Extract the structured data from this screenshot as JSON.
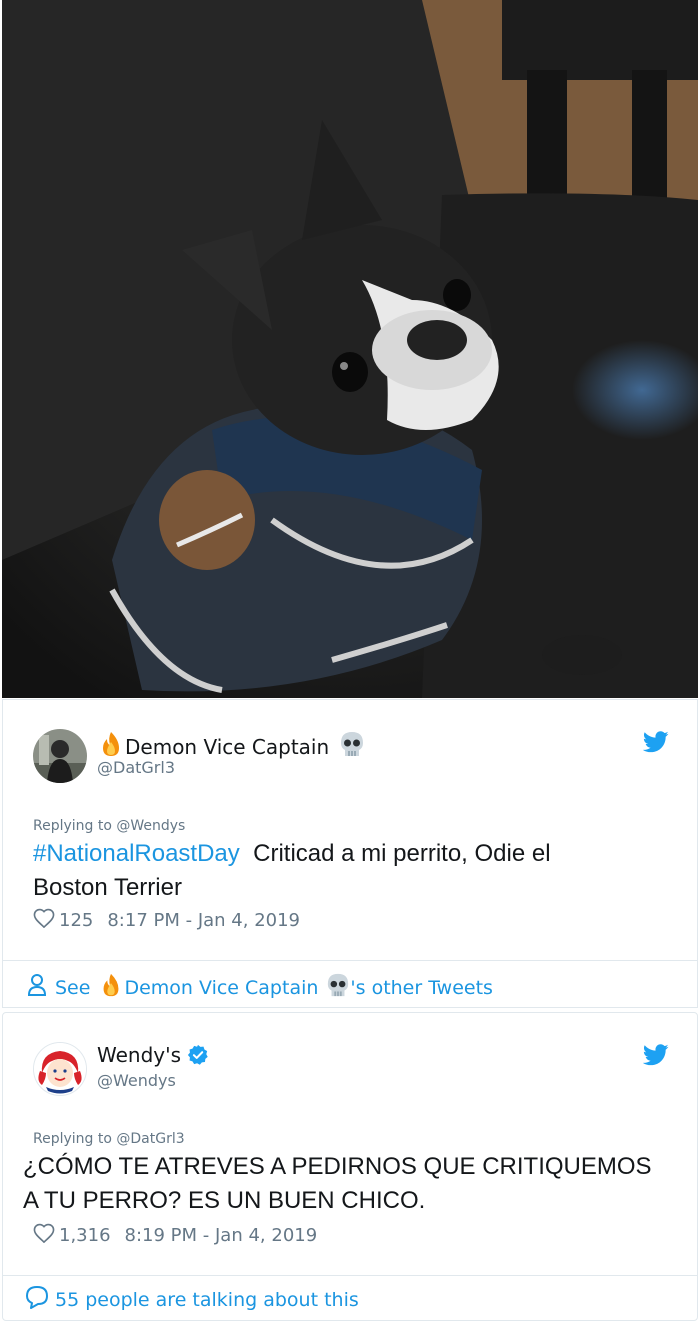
{
  "tweet1": {
    "display_name": "Demon Vice Captain",
    "handle": "@DatGrl3",
    "replying_to": "Replying to @Wendys",
    "hashtag": "#NationalRoastDay",
    "text_line1": "Criticad a mi perrito, Odie el",
    "text_line2": "Boston Terrier",
    "likes": "125",
    "timestamp": "8:17 PM - Jan 4, 2019",
    "footer_see": "See",
    "footer_name": "Demon Vice Captain",
    "footer_suffix": "'s other Tweets"
  },
  "tweet2": {
    "display_name": "Wendy's",
    "handle": "@Wendys",
    "replying_to": "Replying to @DatGrl3",
    "text_line1": "¿CÓMO TE ATREVES A PEDIRNOS QUE CRITIQUEMOS",
    "text_line2": "A TU PERRO? ES UN BUEN CHICO.",
    "likes": "1,316",
    "timestamp": "8:19 PM - Jan 4, 2019",
    "footer_text": "55 people are talking about this"
  },
  "colors": {
    "link_blue": "#1b95e0",
    "twitter_blue": "#1da1f2",
    "text_gray": "#657786",
    "border": "#e1e8ed"
  },
  "icons": [
    "dog-photo",
    "fire-icon",
    "skull-icon",
    "twitter-bird-icon",
    "verified-icon",
    "heart-icon",
    "person-icon",
    "speech-bubble-icon"
  ]
}
